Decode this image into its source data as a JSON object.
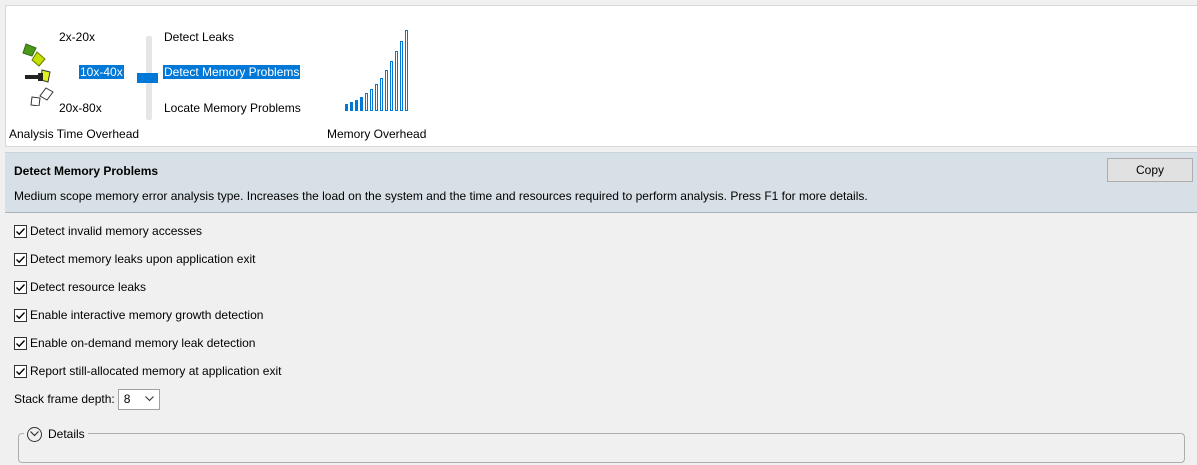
{
  "analysis": {
    "levels": {
      "top": "2x-20x",
      "middle": "10x-40x",
      "bottom": "20x-80x"
    },
    "types": {
      "top": "Detect Leaks",
      "middle": "Detect Memory Problems",
      "bottom": "Locate Memory Problems"
    },
    "selected_level": "middle",
    "time_overhead_caption": "Analysis Time Overhead",
    "memory_overhead_caption": "Memory Overhead"
  },
  "description": {
    "title": "Detect Memory Problems",
    "text": "Medium scope memory error analysis type. Increases the load on the system and the time and resources required to perform analysis. Press F1 for more details.",
    "copy_label": "Copy"
  },
  "options": [
    {
      "label": "Detect invalid memory accesses",
      "checked": true
    },
    {
      "label": "Detect memory leaks upon application exit",
      "checked": true
    },
    {
      "label": "Detect resource leaks",
      "checked": true
    },
    {
      "label": "Enable interactive memory growth detection",
      "checked": true
    },
    {
      "label": "Enable on-demand memory leak detection",
      "checked": true
    },
    {
      "label": "Report still-allocated memory at application exit",
      "checked": true
    }
  ],
  "stack_depth": {
    "label": "Stack frame depth:",
    "value": "8"
  },
  "details": {
    "label": "Details"
  },
  "colors": {
    "accent": "#0078d7",
    "gauge_dark_green": "#4c9a1a",
    "gauge_light_green": "#c6e000"
  }
}
